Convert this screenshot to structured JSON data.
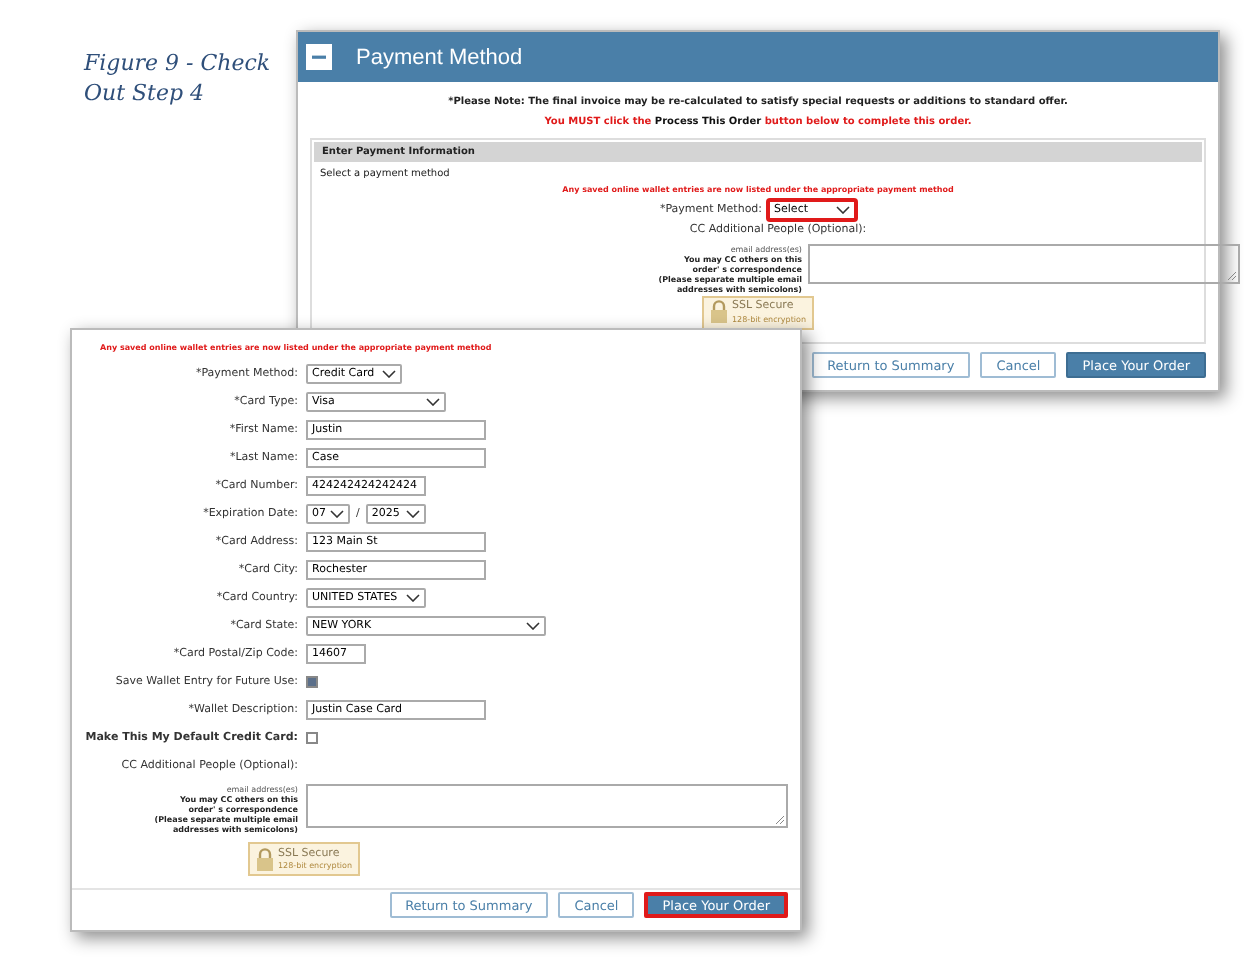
{
  "caption": "Figure 9 - Check Out Step 4",
  "back_window": {
    "title": "Payment Method",
    "note": "*Please Note: The final invoice may be re-calculated to satisfy special requests or additions to standard offer.",
    "instruction": [
      {
        "kind": "alert",
        "text": "You MUST click the"
      },
      {
        "kind": "plain",
        "text": "Process This Order"
      },
      {
        "kind": "alert",
        "text": "button below to complete this order."
      }
    ],
    "panel_heading": "Enter Payment Information",
    "prompt": "Select a payment method",
    "wallet_notice": "Any saved online wallet entries are now listed under the appropriate payment method",
    "payment_method": {
      "label": "*Payment Method:",
      "value": "Select",
      "highlighted": true
    },
    "cc_label": "CC Additional People (Optional):",
    "email_hint": "email address(es)",
    "email_help": "You may CC others on this order' s correspondence (Please separate multiple email addresses with semicolons)",
    "ssl": {
      "title": "SSL Secure",
      "subtitle": "128-bit encryption"
    },
    "buttons": [
      {
        "label": "Return to Summary",
        "kind": "secondary",
        "highlighted": false
      },
      {
        "label": "Cancel",
        "kind": "secondary",
        "highlighted": false
      },
      {
        "label": "Place Your Order",
        "kind": "primary",
        "highlighted": false
      }
    ]
  },
  "front_window": {
    "wallet_notice": "Any saved online wallet entries are now listed under the appropriate payment method",
    "fields": [
      {
        "kind": "select",
        "label": "*Payment Method:",
        "value": "Credit Card"
      },
      {
        "kind": "select",
        "label": "*Card Type:",
        "value": "Visa"
      },
      {
        "kind": "text",
        "label": "*First Name:",
        "value": "Justin"
      },
      {
        "kind": "text",
        "label": "*Last Name:",
        "value": "Case"
      },
      {
        "kind": "text",
        "label": "*Card Number:",
        "value": "424242424242424"
      },
      {
        "kind": "date",
        "label": "*Expiration Date:",
        "month": "07",
        "separator": "/",
        "year": "2025"
      },
      {
        "kind": "text",
        "label": "*Card Address:",
        "value": "123 Main St"
      },
      {
        "kind": "text",
        "label": "*Card City:",
        "value": "Rochester"
      },
      {
        "kind": "select",
        "label": "*Card Country:",
        "value": "UNITED STATES"
      },
      {
        "kind": "select",
        "label": "*Card State:",
        "value": "NEW YORK"
      },
      {
        "kind": "text",
        "label": "*Card Postal/Zip Code:",
        "value": "14607"
      },
      {
        "kind": "checkbox",
        "label": "Save Wallet Entry for Future Use:",
        "checked": true,
        "bold": false
      },
      {
        "kind": "text",
        "label": "*Wallet Description:",
        "value": "Justin Case Card"
      },
      {
        "kind": "checkbox",
        "label": "Make This My Default Credit Card:",
        "checked": false,
        "bold": true
      },
      {
        "kind": "label",
        "label": "CC Additional People (Optional):"
      }
    ],
    "email_hint": "email address(es)",
    "email_help": "You may CC others on this order' s correspondence (Please separate multiple email addresses with semicolons)",
    "ssl": {
      "title": "SSL Secure",
      "subtitle": "128-bit encryption"
    },
    "buttons": [
      {
        "label": "Return to Summary",
        "kind": "secondary",
        "highlighted": false
      },
      {
        "label": "Cancel",
        "kind": "secondary",
        "highlighted": false
      },
      {
        "label": "Place Your Order",
        "kind": "primary",
        "highlighted": true
      }
    ]
  }
}
